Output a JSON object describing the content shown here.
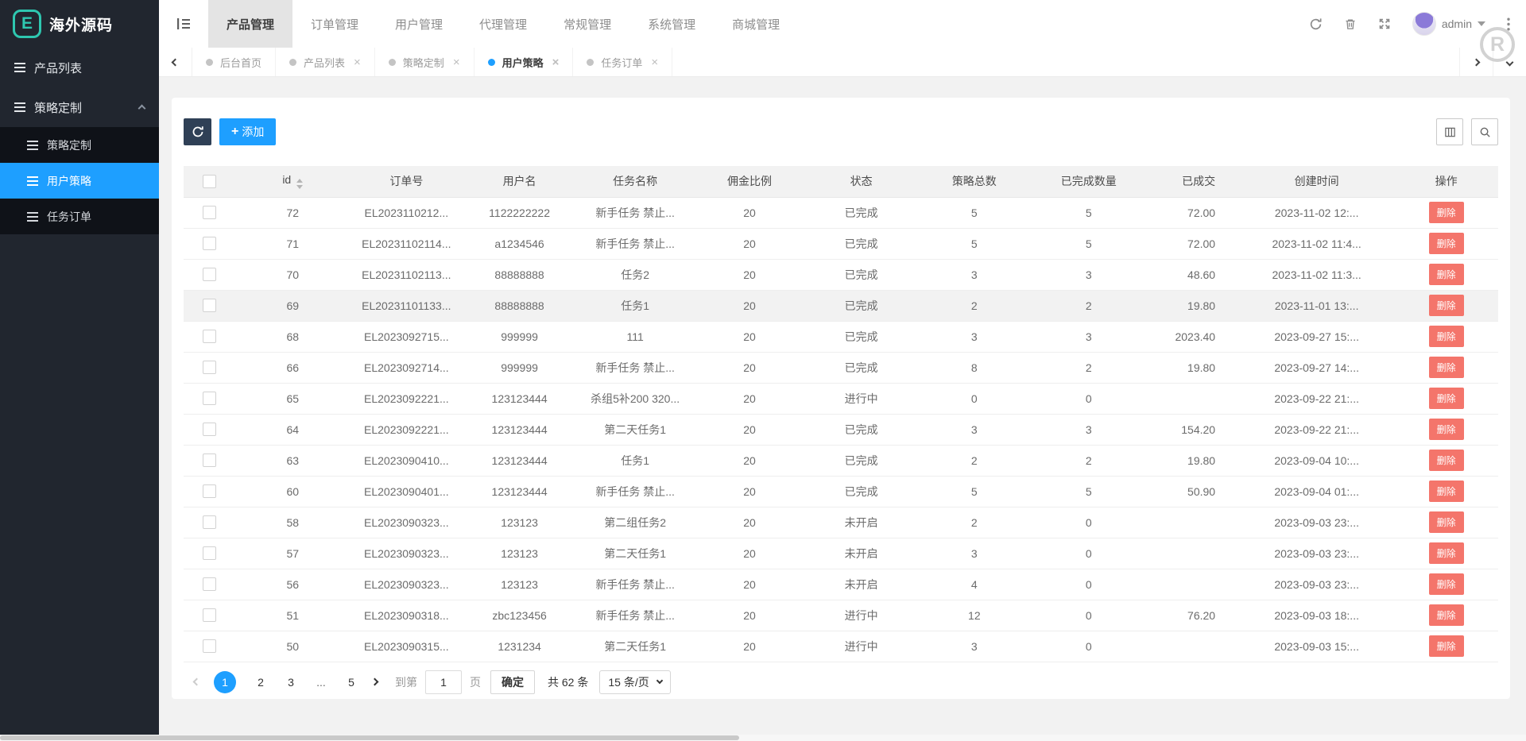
{
  "brand": {
    "logo_letter": "E",
    "title": "海外源码"
  },
  "sidebar": {
    "items": [
      {
        "label": "产品列表"
      },
      {
        "label": "策略定制"
      }
    ],
    "submenu": [
      {
        "label": "策略定制"
      },
      {
        "label": "用户策略",
        "active": true
      },
      {
        "label": "任务订单"
      }
    ]
  },
  "topnav": {
    "items": [
      {
        "label": "产品管理",
        "active": true
      },
      {
        "label": "订单管理"
      },
      {
        "label": "用户管理"
      },
      {
        "label": "代理管理"
      },
      {
        "label": "常规管理"
      },
      {
        "label": "系统管理"
      },
      {
        "label": "商城管理"
      }
    ],
    "username": "admin",
    "watermark": "R"
  },
  "tabbar": {
    "tabs": [
      {
        "label": "后台首页",
        "closable": false,
        "active": false
      },
      {
        "label": "产品列表",
        "closable": true,
        "active": false
      },
      {
        "label": "策略定制",
        "closable": true,
        "active": false
      },
      {
        "label": "用户策略",
        "closable": true,
        "active": true
      },
      {
        "label": "任务订单",
        "closable": true,
        "active": false
      }
    ]
  },
  "toolbar": {
    "add_plus": "+",
    "add_label": "添加"
  },
  "table": {
    "columns": [
      "",
      "id",
      "订单号",
      "用户名",
      "任务名称",
      "佣金比例",
      "状态",
      "策略总数",
      "已完成数量",
      "已成交",
      "创建时间",
      "操作"
    ],
    "delete_label": "删除",
    "rows": [
      {
        "id": "72",
        "order": "EL2023110212...",
        "user": "1122222222",
        "task": "新手任务 禁止...",
        "ratio": "20",
        "status": "已完成",
        "total": "5",
        "done": "5",
        "volume": "72.00",
        "created": "2023-11-02 12:...",
        "highlight": false
      },
      {
        "id": "71",
        "order": "EL20231102114...",
        "user": "a1234546",
        "task": "新手任务 禁止...",
        "ratio": "20",
        "status": "已完成",
        "total": "5",
        "done": "5",
        "volume": "72.00",
        "created": "2023-11-02 11:4...",
        "highlight": false
      },
      {
        "id": "70",
        "order": "EL20231102113...",
        "user": "88888888",
        "task": "任务2",
        "ratio": "20",
        "status": "已完成",
        "total": "3",
        "done": "3",
        "volume": "48.60",
        "created": "2023-11-02 11:3...",
        "highlight": false
      },
      {
        "id": "69",
        "order": "EL20231101133...",
        "user": "88888888",
        "task": "任务1",
        "ratio": "20",
        "status": "已完成",
        "total": "2",
        "done": "2",
        "volume": "19.80",
        "created": "2023-11-01 13:...",
        "highlight": true
      },
      {
        "id": "68",
        "order": "EL2023092715...",
        "user": "999999",
        "task": "111",
        "ratio": "20",
        "status": "已完成",
        "total": "3",
        "done": "3",
        "volume": "2023.40",
        "created": "2023-09-27 15:...",
        "highlight": false
      },
      {
        "id": "66",
        "order": "EL2023092714...",
        "user": "999999",
        "task": "新手任务 禁止...",
        "ratio": "20",
        "status": "已完成",
        "total": "8",
        "done": "2",
        "volume": "19.80",
        "created": "2023-09-27 14:...",
        "highlight": false
      },
      {
        "id": "65",
        "order": "EL2023092221...",
        "user": "123123444",
        "task": "杀组5补200 320...",
        "ratio": "20",
        "status": "进行中",
        "total": "0",
        "done": "0",
        "volume": "",
        "created": "2023-09-22 21:...",
        "highlight": false
      },
      {
        "id": "64",
        "order": "EL2023092221...",
        "user": "123123444",
        "task": "第二天任务1",
        "ratio": "20",
        "status": "已完成",
        "total": "3",
        "done": "3",
        "volume": "154.20",
        "created": "2023-09-22 21:...",
        "highlight": false
      },
      {
        "id": "63",
        "order": "EL2023090410...",
        "user": "123123444",
        "task": "任务1",
        "ratio": "20",
        "status": "已完成",
        "total": "2",
        "done": "2",
        "volume": "19.80",
        "created": "2023-09-04 10:...",
        "highlight": false
      },
      {
        "id": "60",
        "order": "EL2023090401...",
        "user": "123123444",
        "task": "新手任务 禁止...",
        "ratio": "20",
        "status": "已完成",
        "total": "5",
        "done": "5",
        "volume": "50.90",
        "created": "2023-09-04 01:...",
        "highlight": false
      },
      {
        "id": "58",
        "order": "EL2023090323...",
        "user": "123123",
        "task": "第二组任务2",
        "ratio": "20",
        "status": "未开启",
        "total": "2",
        "done": "0",
        "volume": "",
        "created": "2023-09-03 23:...",
        "highlight": false
      },
      {
        "id": "57",
        "order": "EL2023090323...",
        "user": "123123",
        "task": "第二天任务1",
        "ratio": "20",
        "status": "未开启",
        "total": "3",
        "done": "0",
        "volume": "",
        "created": "2023-09-03 23:...",
        "highlight": false
      },
      {
        "id": "56",
        "order": "EL2023090323...",
        "user": "123123",
        "task": "新手任务 禁止...",
        "ratio": "20",
        "status": "未开启",
        "total": "4",
        "done": "0",
        "volume": "",
        "created": "2023-09-03 23:...",
        "highlight": false
      },
      {
        "id": "51",
        "order": "EL2023090318...",
        "user": "zbc123456",
        "task": "新手任务 禁止...",
        "ratio": "20",
        "status": "进行中",
        "total": "12",
        "done": "0",
        "volume": "76.20",
        "created": "2023-09-03 18:...",
        "highlight": false
      },
      {
        "id": "50",
        "order": "EL2023090315...",
        "user": "1231234",
        "task": "第二天任务1",
        "ratio": "20",
        "status": "进行中",
        "total": "3",
        "done": "0",
        "volume": "",
        "created": "2023-09-03 15:...",
        "highlight": false
      }
    ]
  },
  "pagination": {
    "pages": [
      {
        "label": "1",
        "active": true
      },
      {
        "label": "2"
      },
      {
        "label": "3"
      },
      {
        "label": "...",
        "ellipsis": true
      },
      {
        "label": "5"
      }
    ],
    "goto_label": "到第",
    "goto_value": "1",
    "page_unit": "页",
    "confirm_label": "确定",
    "total_label": "共 62 条",
    "page_size": "15 条/页"
  },
  "colors": {
    "accent": "#1E9FFF",
    "danger": "#f4756b",
    "dark_button": "#2f4056",
    "brand_teal": "#2ec7b0"
  }
}
